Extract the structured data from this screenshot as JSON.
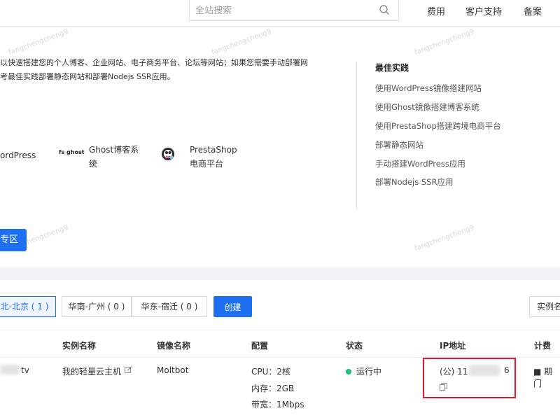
{
  "topbar": {
    "search_placeholder": "全站搜索",
    "nav": [
      "费用",
      "客户支持",
      "备案"
    ]
  },
  "intro": {
    "line1": "以快速搭建您的个人博客、企业网站、电子商务平台、论坛等网站；如果您需要手动部署网",
    "line2": "考最佳实践部署静态网站和部署Nodejs SSR应用。"
  },
  "apps": [
    {
      "name1": "ordPress",
      "name2": ""
    },
    {
      "logo": "fs ghost",
      "name1": "Ghost博客系",
      "name2": "统"
    },
    {
      "name1": "PrestaShop",
      "name2": "电商平台"
    }
  ],
  "best_practice": {
    "title": "最佳实践",
    "links": [
      "使用WordPress镜像搭建网站",
      "使用Ghost镜像搭建博客系统",
      "使用PrestaShop搭建跨境电商平台",
      "部署静态网站",
      "手动搭建WordPress应用",
      "部署Nodejs SSR应用"
    ]
  },
  "zone_button": "专区",
  "watermark": "fangchengcheng9",
  "regions": [
    {
      "label": "北-北京 ( 1 )",
      "active": true
    },
    {
      "label": "华南-广州 ( 0 )",
      "active": false
    },
    {
      "label": "华东-宿迁 ( 0 )",
      "active": false
    }
  ],
  "create_label": "创建",
  "filter_label": "实例名",
  "table": {
    "headers": [
      "实例名称",
      "镜像名称",
      "配置",
      "状态",
      "IP地址",
      "计费"
    ],
    "row": {
      "id_suffix": "tv",
      "name": "我的轻量云主机",
      "edit_icon": "edit-icon",
      "image": "Moltbot",
      "cpu": "CPU：2核",
      "mem": "内存：2GB",
      "bw": "带宽：1Mbps",
      "status": "运行中",
      "ip_prefix": "(公) 11",
      "ip_suffix": "6",
      "billing": "■ 期门"
    }
  },
  "colors": {
    "accent": "#1e6ff1",
    "running": "#1fbf75",
    "highlight": "#e01e2b"
  }
}
